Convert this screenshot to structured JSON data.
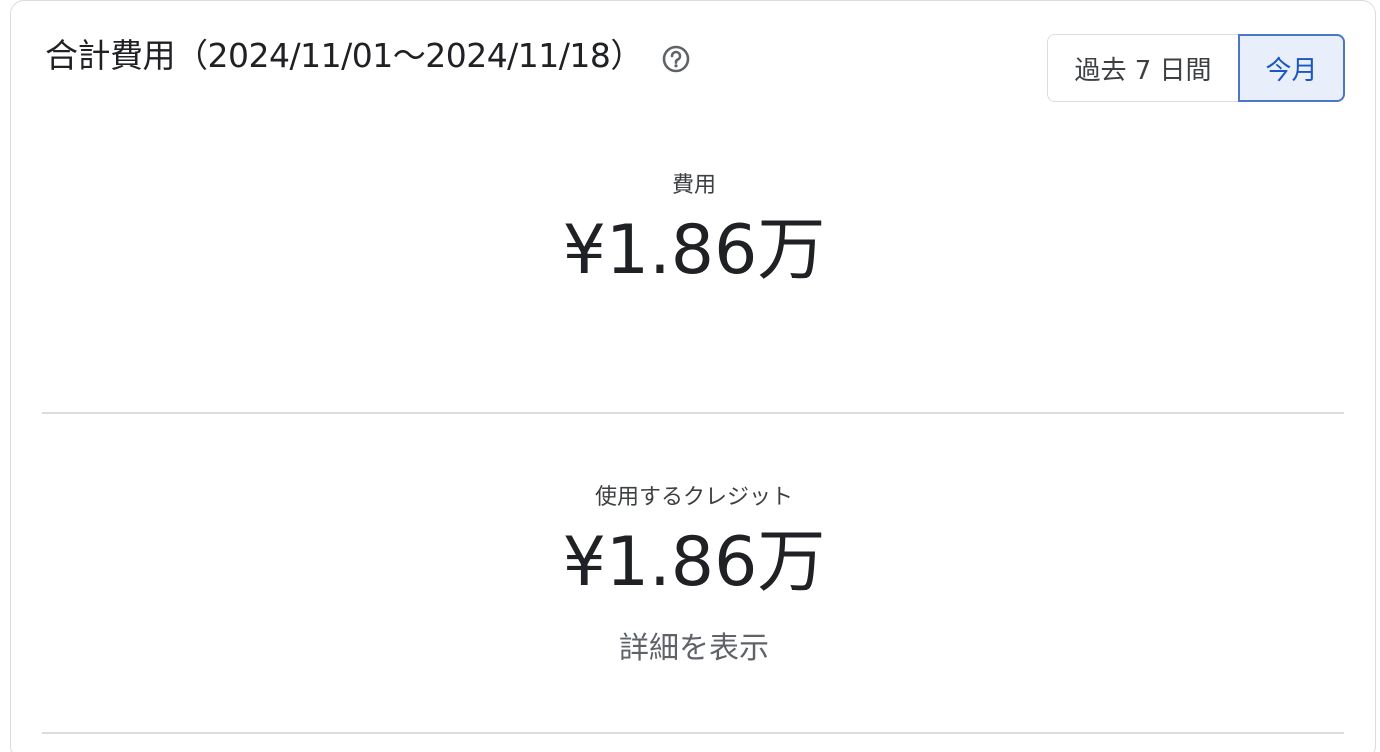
{
  "card": {
    "title": "合計費用（2024/11/01〜2024/11/18）",
    "help_icon": "help-circle-icon",
    "range_toggle": {
      "past_label": "過去 7 日間",
      "current_label": "今月",
      "selected": "今月"
    }
  },
  "cost": {
    "label": "費用",
    "value": "¥1.86万"
  },
  "credits": {
    "label": "使用するクレジット",
    "value": "¥1.86万",
    "details_link": "詳細を表示"
  },
  "colors": {
    "accent": "#1a56c4",
    "selected_bg": "#e8effb",
    "border": "#dadce0",
    "text": "#202124",
    "muted": "#5f6368"
  }
}
